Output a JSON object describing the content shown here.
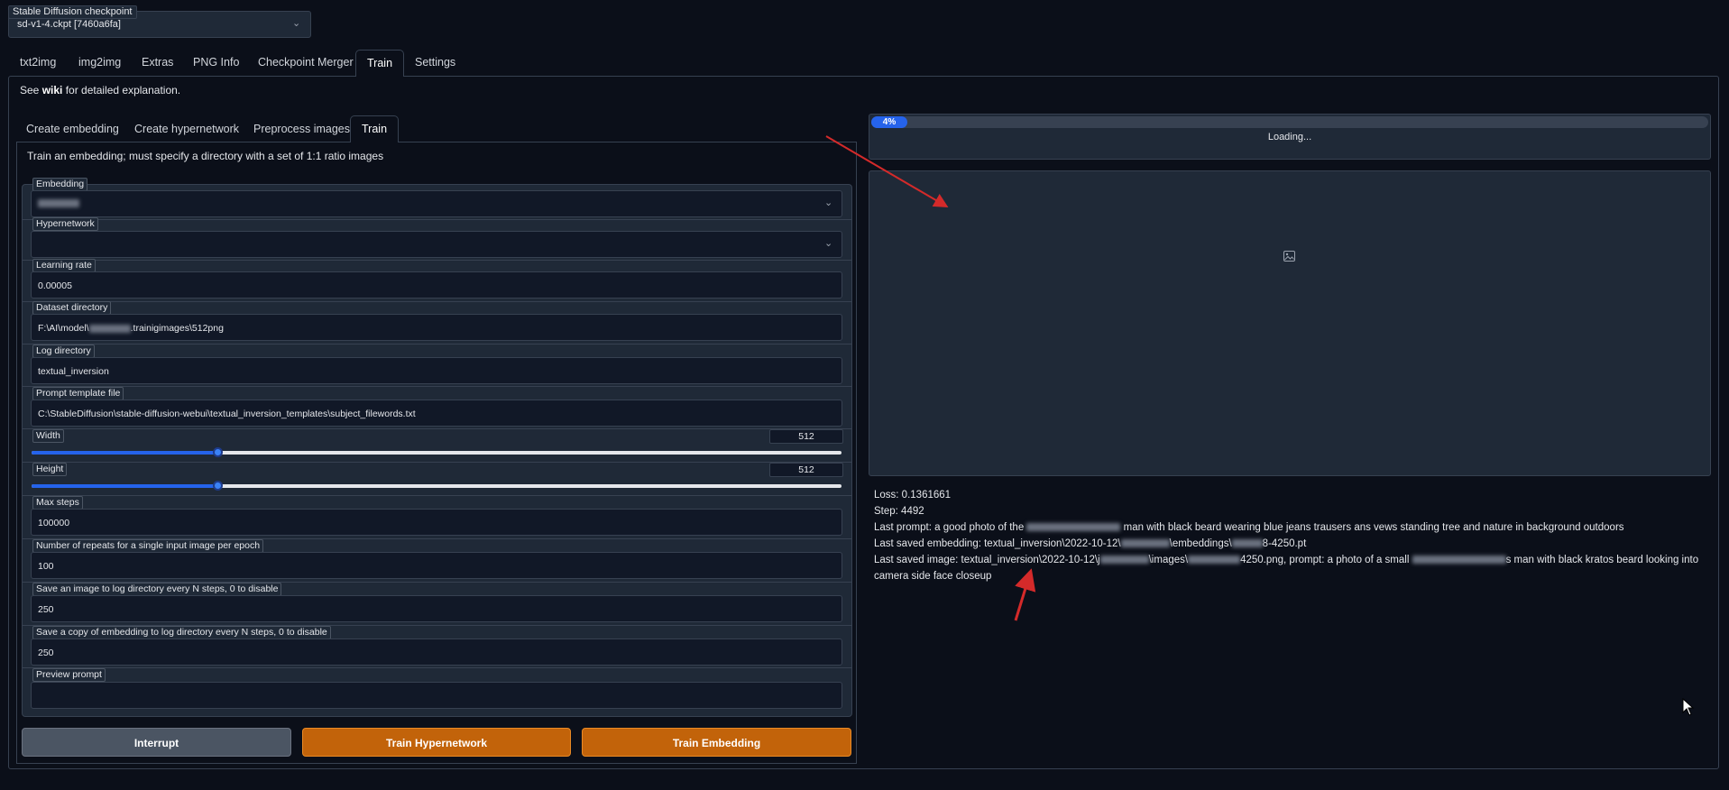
{
  "checkpoint": {
    "label": "Stable Diffusion checkpoint",
    "value": "sd-v1-4.ckpt [7460a6fa]"
  },
  "main_tabs": [
    "txt2img",
    "img2img",
    "Extras",
    "PNG Info",
    "Checkpoint Merger",
    "Train",
    "Settings"
  ],
  "active_main_tab": "Train",
  "wiki_note": {
    "prefix": "See ",
    "link": "wiki",
    "suffix": " for detailed explanation."
  },
  "sub_tabs": [
    "Create embedding",
    "Create hypernetwork",
    "Preprocess images",
    "Train"
  ],
  "active_sub_tab": "Train",
  "train_description": "Train an embedding; must specify a directory with a set of 1:1 ratio images",
  "form": {
    "embedding_label": "Embedding",
    "hypernetwork_label": "Hypernetwork",
    "learning_rate_label": "Learning rate",
    "learning_rate_value": "0.00005",
    "dataset_dir_label": "Dataset directory",
    "dataset_dir_prefix": "F:\\AI\\model\\",
    "dataset_dir_suffix": ".trainigimages\\512png",
    "log_dir_label": "Log directory",
    "log_dir_value": "textual_inversion",
    "prompt_template_label": "Prompt template file",
    "prompt_template_value": "C:\\StableDiffusion\\stable-diffusion-webui\\textual_inversion_templates\\subject_filewords.txt",
    "width_label": "Width",
    "width_value": "512",
    "height_label": "Height",
    "height_value": "512",
    "max_steps_label": "Max steps",
    "max_steps_value": "100000",
    "repeats_label": "Number of repeats for a single input image per epoch",
    "repeats_value": "100",
    "save_image_label": "Save an image to log directory every N steps, 0 to disable",
    "save_image_value": "250",
    "save_embedding_label": "Save a copy of embedding to log directory every N steps, 0 to disable",
    "save_embedding_value": "250",
    "preview_prompt_label": "Preview prompt",
    "preview_prompt_value": ""
  },
  "buttons": {
    "interrupt": "Interrupt",
    "train_hypernetwork": "Train Hypernetwork",
    "train_embedding": "Train Embedding"
  },
  "progress": {
    "percent_label": "4%",
    "fraction": 0.04,
    "status": "Loading..."
  },
  "info": {
    "loss": "Loss: 0.1361661",
    "step": "Step: 4492",
    "last_prompt_a": "Last prompt: a good photo of the ",
    "last_prompt_b": " man with black beard wearing blue jeans trausers ans vews standing tree and nature in background outdoors",
    "last_emb_a": "Last saved embedding: textual_inversion\\2022-10-12\\",
    "last_emb_b": "\\embeddings\\",
    "last_emb_c": "8-4250.pt",
    "last_img_a": "Last saved image: textual_inversion\\2022-10-12\\j",
    "last_img_b": "\\images\\",
    "last_img_c": "4250.png, prompt: a photo of a small ",
    "last_img_d": "s man with black kratos beard looking into camera side face closeup"
  },
  "colors": {
    "background": "#0b0f19",
    "panel": "#1f2937",
    "accent_blue": "#2563eb",
    "button_orange": "#c2630a",
    "annotation_red": "#d42a2a"
  }
}
